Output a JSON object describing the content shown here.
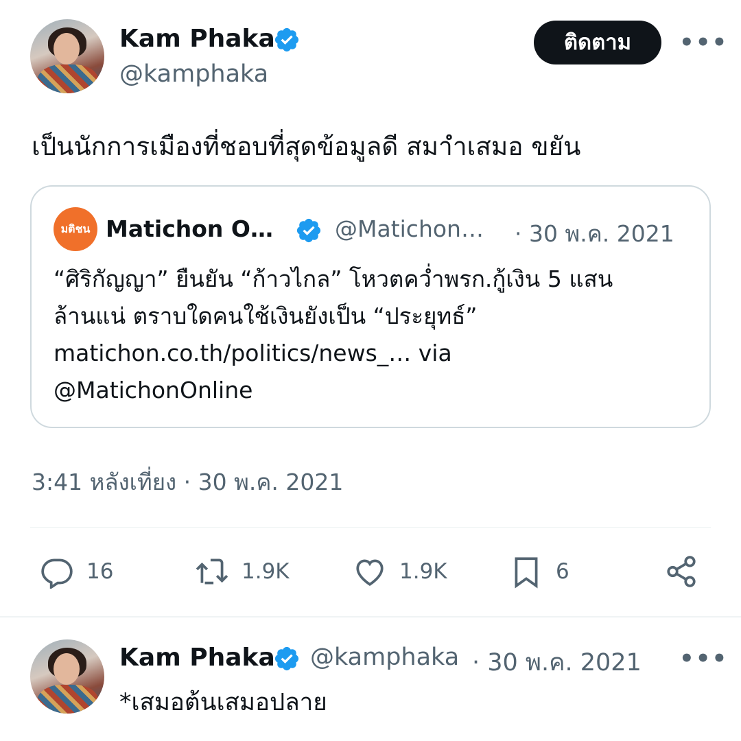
{
  "main_tweet": {
    "author_name": "Kam Phaka",
    "author_handle": "@kamphaka",
    "follow_label": "ติดตาม",
    "more_label": "•••",
    "text": "เป็นนักการเมืองที่ชอบที่สุดข้อมูลดี สมาำเสมอ ขยัน",
    "timestamp": "3:41 หลังเที่ยง · 30 พ.ค. 2021"
  },
  "quoted_tweet": {
    "logo_text": "มติชน",
    "author_name": "Matichon O…",
    "author_handle": "@Matichon…",
    "date": "· 30 พ.ค. 2021",
    "lines": [
      "“ศิริกัญญา” ยืนยัน “ก้าวไกล” โหวตคว่ำพรก.กู้เงิน 5 แสน",
      "ล้านแน่ ตราบใดคนใช้เงินยังเป็น “ประยุทธ์”",
      "matichon.co.th/politics/news_… via",
      "@MatichonOnline"
    ]
  },
  "actions": {
    "replies": "16",
    "retweets": "1.9K",
    "likes": "1.9K",
    "bookmarks": "6"
  },
  "reply_tweet": {
    "author_name": "Kam Phaka",
    "author_handle": "@kamphaka",
    "date": "· 30 พ.ค. 2021",
    "more_label": "•••",
    "text": "*เสมอต้นเสมอปลาย"
  },
  "colors": {
    "verified": "#1d9bf0",
    "text_primary": "#0f1419",
    "text_secondary": "#536471",
    "border": "#cfd9de"
  }
}
